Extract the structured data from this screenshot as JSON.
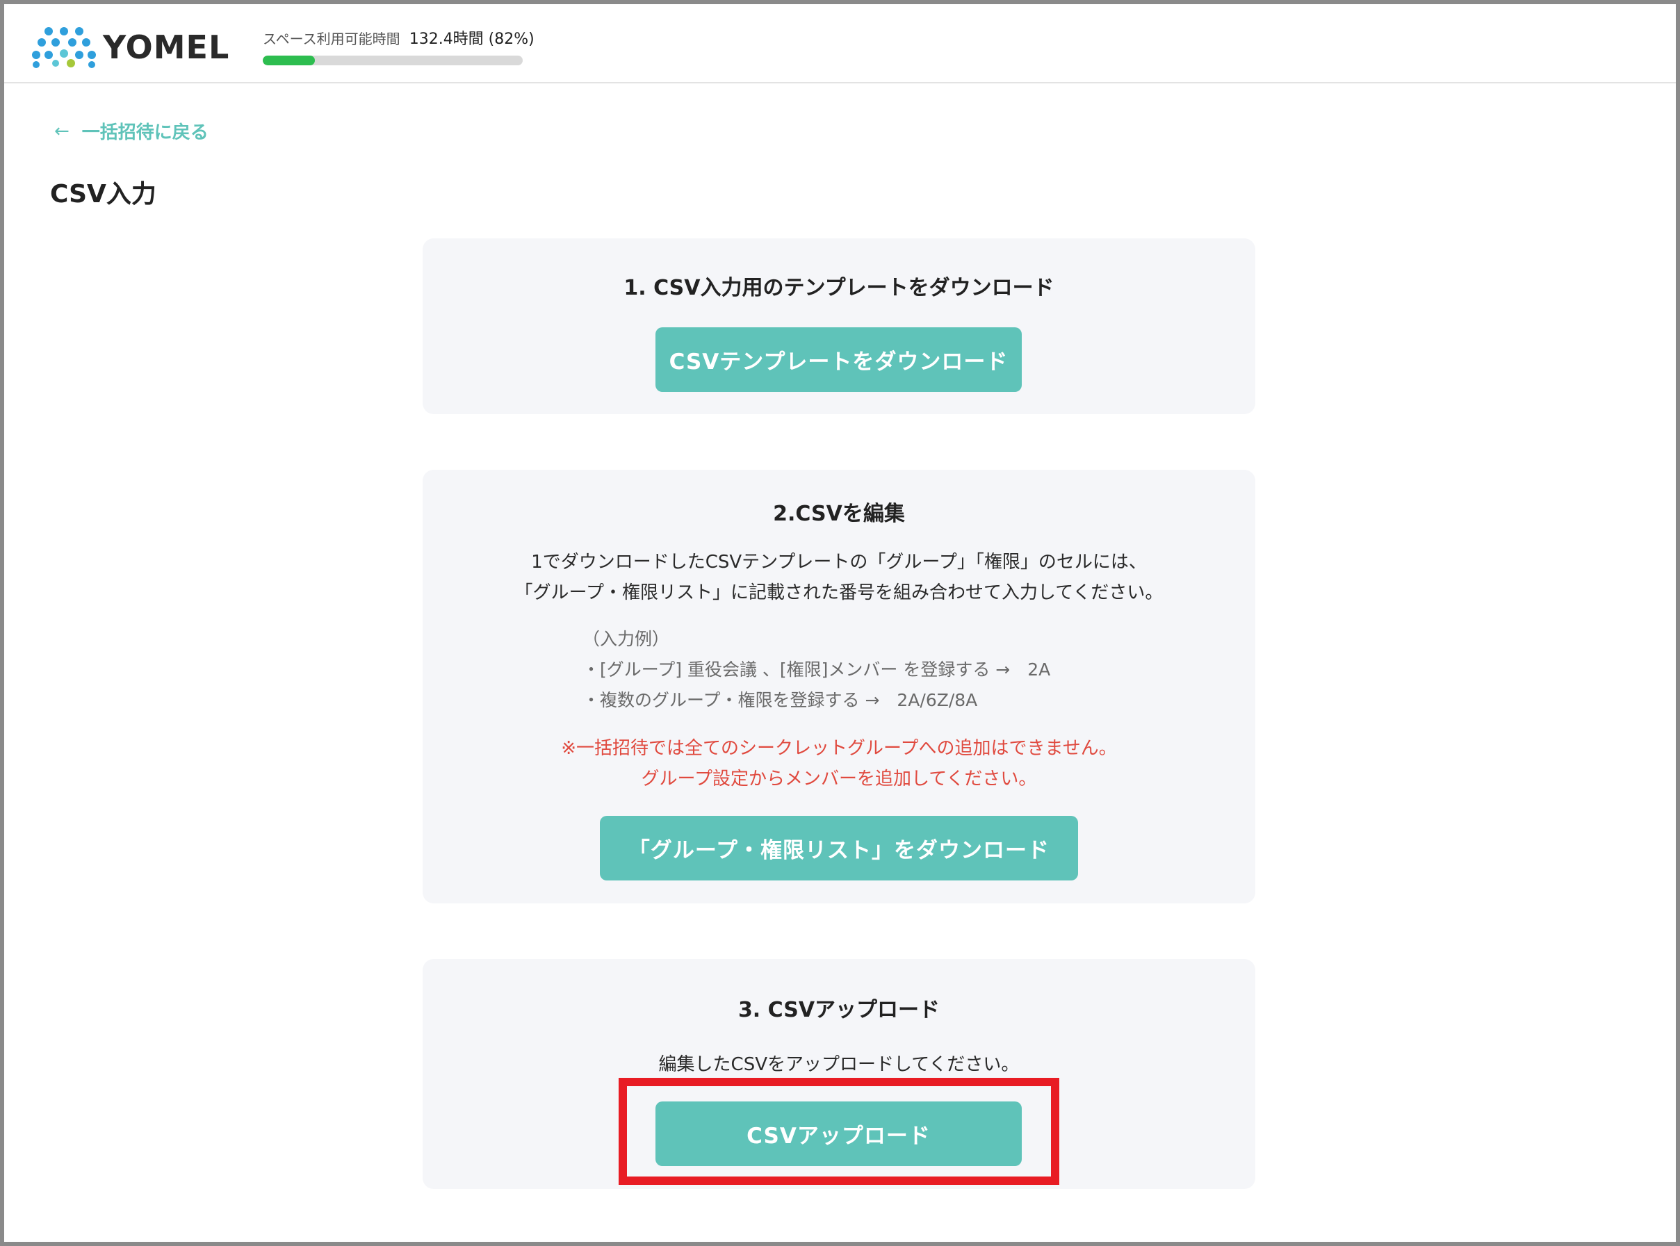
{
  "header": {
    "logo_text": "YOMEL",
    "usage_label": "スペース利用可能時間",
    "usage_value": "132.4時間 (82%)",
    "usage_fraction": 0.2,
    "usage_color": "#2dbd4f"
  },
  "nav": {
    "back_label": "一括招待に戻る"
  },
  "page": {
    "title": "CSV入力"
  },
  "step1": {
    "title": "1. CSV入力用のテンプレートをダウンロード",
    "button_label": "CSVテンプレートをダウンロード"
  },
  "step2": {
    "title": "2.CSVを編集",
    "description": [
      "1でダウンロードしたCSVテンプレートの「グループ」「権限」のセルには、",
      "「グループ・権限リスト」に記載された番号を組み合わせて入力してください。"
    ],
    "example": [
      "（入力例）",
      "・[グループ] 重役会議 、[権限]メンバー を登録する →　2A",
      "・複数のグループ・権限を登録する →　2A/6Z/8A"
    ],
    "warning": [
      "※一括招待では全てのシークレットグループへの追加はできません。",
      "グループ設定からメンバーを追加してください。"
    ],
    "button_label": "「グループ・権限リスト」をダウンロード"
  },
  "step3": {
    "title": "3. CSVアップロード",
    "description": "編集したCSVをアップロードしてください。",
    "button_label": "CSVアップロード"
  },
  "colors": {
    "accent": "#5fc3b9",
    "card_bg": "#f5f6f9",
    "warning": "#e04a3f",
    "highlight": "#e81c24"
  }
}
